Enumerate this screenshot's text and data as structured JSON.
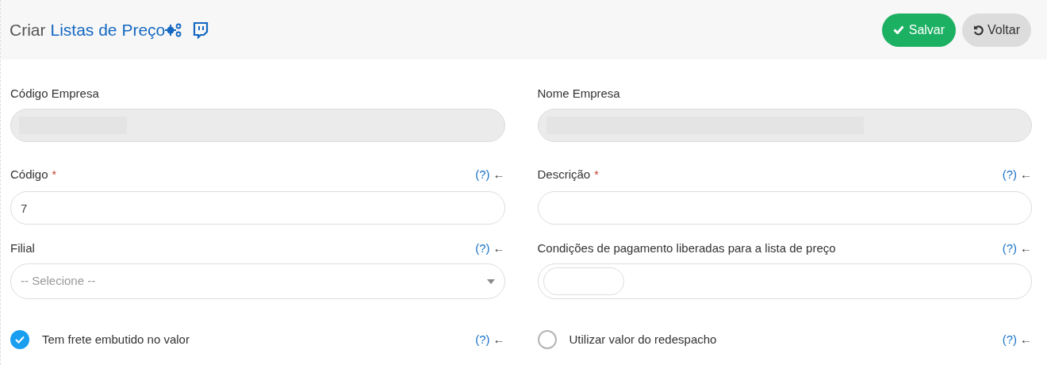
{
  "header": {
    "title_prefix": "Criar",
    "title_link": "Listas de Preço"
  },
  "buttons": [
    {
      "kind": "save",
      "label": "Salvar"
    },
    {
      "kind": "back",
      "label": "Voltar"
    }
  ],
  "fields": [
    {
      "kind": "disabled",
      "label": "Código Empresa",
      "disabled": true
    },
    {
      "kind": "disabled",
      "label": "Nome Empresa",
      "disabled": true
    },
    {
      "kind": "text",
      "label": "Código",
      "required_mark": "*",
      "help": "(?)",
      "arrow": "←",
      "value": "7"
    },
    {
      "kind": "text",
      "label": "Descrição",
      "required_mark": "*",
      "help": "(?)",
      "arrow": "←"
    },
    {
      "kind": "select",
      "label": "Filial",
      "help": "(?)",
      "arrow": "←",
      "placeholder": "-- Selecione --"
    },
    {
      "kind": "tags",
      "label": "Condições de pagamento liberadas para a lista de preço",
      "help": "(?)",
      "arrow": "←"
    },
    {
      "kind": "checkbox",
      "label": "Tem frete embutido no valor",
      "checked": true,
      "help": "(?)",
      "arrow": "←"
    },
    {
      "kind": "checkbox",
      "label": "Utilizar valor do redespacho",
      "checked": false,
      "help": "(?)",
      "arrow": "←"
    }
  ]
}
